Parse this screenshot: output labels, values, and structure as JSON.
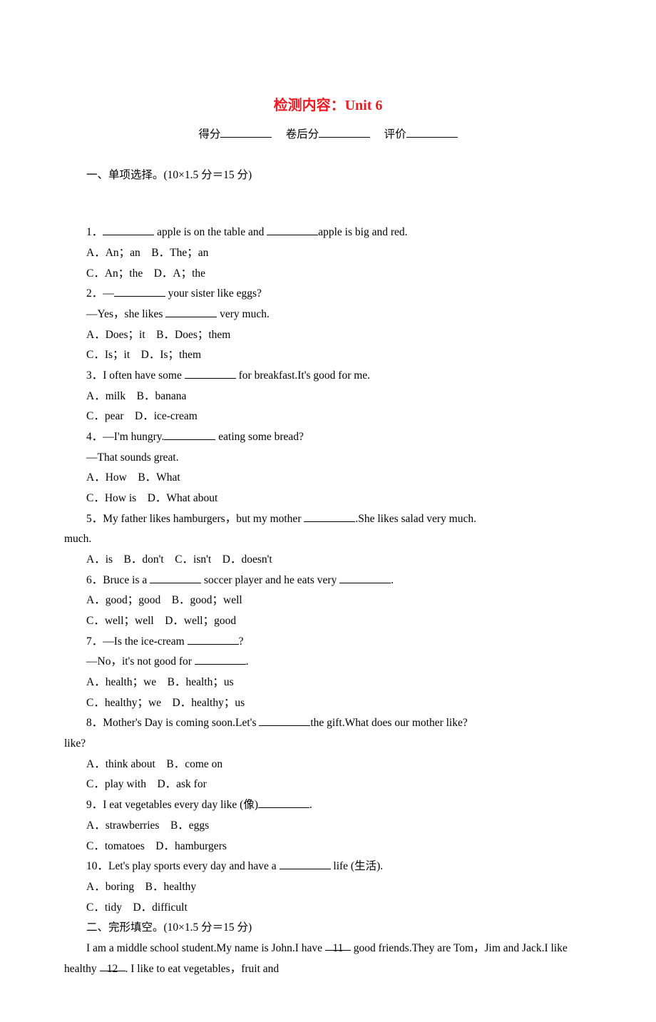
{
  "title": "检测内容：Unit 6",
  "score": {
    "s1": "得分",
    "s2": "卷后分",
    "s3": "评价"
  },
  "section1": {
    "heading": "一、单项选择。(10×1.5 分＝15 分)",
    "q1": {
      "stem_a": "1．",
      "stem_b": " apple is on the table and ",
      "stem_c": "apple is big and red.",
      "ab": "A．An；an　B．The；an",
      "cd": "C．An；the　D．A；the"
    },
    "q2": {
      "stem_a": "2．—",
      "stem_b": " your sister like eggs?",
      "line2_a": "—Yes，she likes ",
      "line2_b": " very much.",
      "ab": "A．Does；it　B．Does；them",
      "cd": "C．Is；it　D．Is；them"
    },
    "q3": {
      "stem_a": "3．I often have some ",
      "stem_b": " for breakfast.It's good for me.",
      "ab": "A．milk　B．banana",
      "cd": "C．pear　D．ice-cream"
    },
    "q4": {
      "stem_a": "4．—I'm hungry.",
      "stem_b": " eating some bread?",
      "line2": "—That sounds great.",
      "ab": "A．How　B．What",
      "cd": "C．How is　D．What about"
    },
    "q5": {
      "stem_a": "5．My father likes hamburgers，but my mother ",
      "stem_b": ".She likes salad very much.",
      "abcd": "A．is　B．don't　C．isn't　D．doesn't"
    },
    "q6": {
      "stem_a": "6．Bruce is a ",
      "stem_b": " soccer player and he eats very ",
      "stem_c": ".",
      "ab": "A．good；good　B．good；well",
      "cd": "C．well；well　D．well；good"
    },
    "q7": {
      "stem_a": "7．—Is the ice-cream ",
      "stem_b": "?",
      "line2_a": "—No，it's not good for ",
      "line2_b": ".",
      "ab": "A．health；we　B．health；us",
      "cd": "C．healthy；we　D．healthy；us"
    },
    "q8": {
      "stem_a": "8．Mother's Day is coming soon.Let's ",
      "stem_b": "the gift.What does our mother like?",
      "ab": "A．think about　B．come on",
      "cd": "C．play with　D．ask for"
    },
    "q9": {
      "stem_a": "9．I eat vegetables every day like (像)",
      "stem_b": ".",
      "ab": "A．strawberries　B．eggs",
      "cd": "C．tomatoes　D．hamburgers"
    },
    "q10": {
      "stem_a": "10．Let's play sports every day and have a ",
      "stem_b": " life (生活).",
      "ab": "A．boring　B．healthy",
      "cd": "C．tidy　D．difficult"
    }
  },
  "section2": {
    "heading": "二、完形填空。(10×1.5 分＝15 分)",
    "p1_a": "I am a middle school student.My name is John.I have ",
    "b11": "11",
    "p1_b": " good friends.They are Tom，Jim and Jack.I like healthy ",
    "b12": "12",
    "p1_c": ". I like to eat vegetables，fruit and"
  }
}
